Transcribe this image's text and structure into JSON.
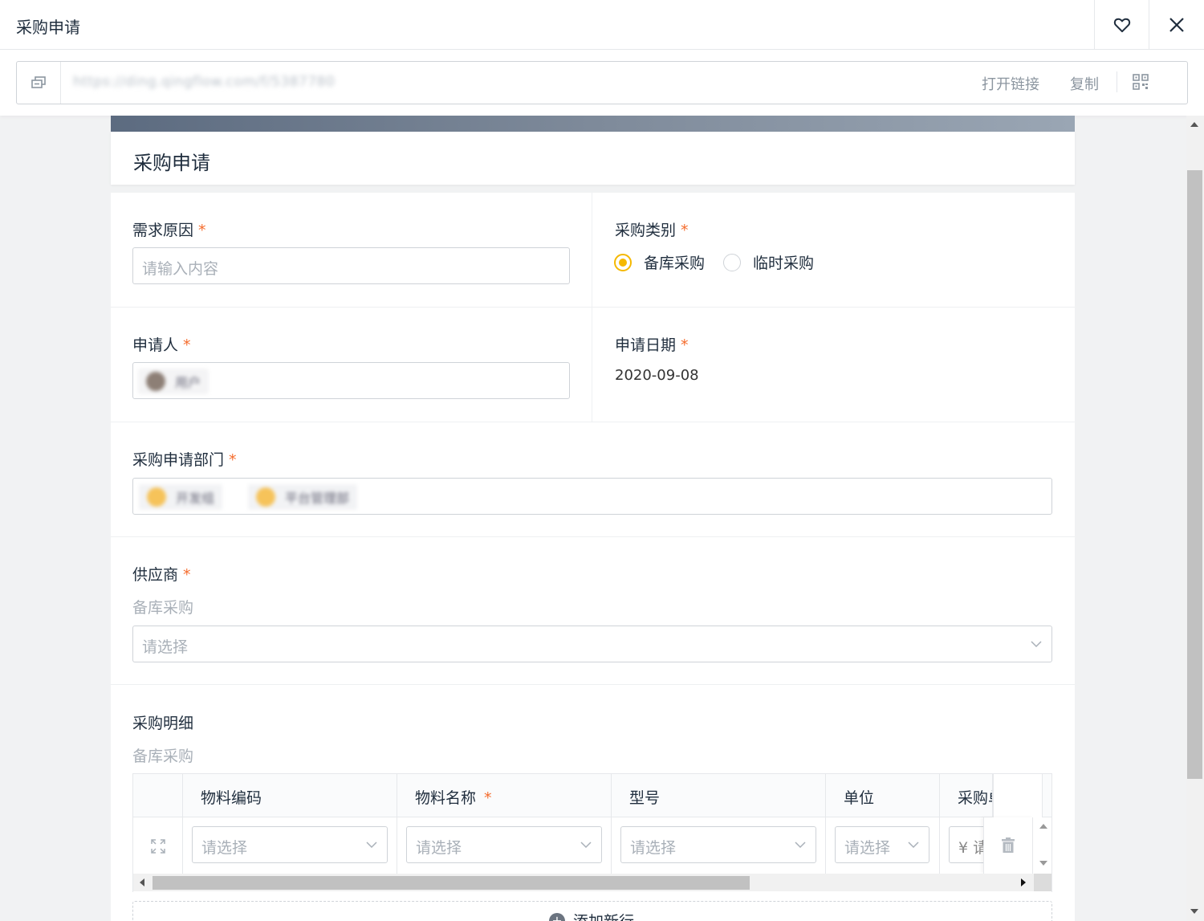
{
  "window": {
    "title": "采购申请"
  },
  "urlbar": {
    "url": "https://ding.qingflow.com/f/5387780",
    "open_link": "打开链接",
    "copy": "复制"
  },
  "form": {
    "title": "采购申请",
    "fields": {
      "reason": {
        "label": "需求原因",
        "required": "*",
        "placeholder": "请输入内容"
      },
      "category": {
        "label": "采购类别",
        "required": "*",
        "options": [
          "备库采购",
          "临时采购"
        ],
        "selected": "备库采购"
      },
      "applicant": {
        "label": "申请人",
        "required": "*",
        "value": "用户"
      },
      "date": {
        "label": "申请日期",
        "required": "*",
        "value": "2020-09-08"
      },
      "department": {
        "label": "采购申请部门",
        "required": "*",
        "chips": [
          "开发组",
          "平台管理部"
        ]
      },
      "supplier": {
        "label": "供应商",
        "required": "*",
        "hint": "备库采购",
        "placeholder": "请选择"
      },
      "details": {
        "label": "采购明细",
        "hint": "备库采购",
        "columns": [
          "物料编码",
          "物料名称",
          "型号",
          "单位",
          "采购单价"
        ],
        "name_required": "*",
        "row_placeholders": [
          "请选择",
          "请选择",
          "请选择",
          "请选择",
          "¥ 请输入"
        ],
        "add_row": "添加新行"
      }
    }
  },
  "colors": {
    "accent": "#f5b800",
    "required": "#f56c2d"
  }
}
